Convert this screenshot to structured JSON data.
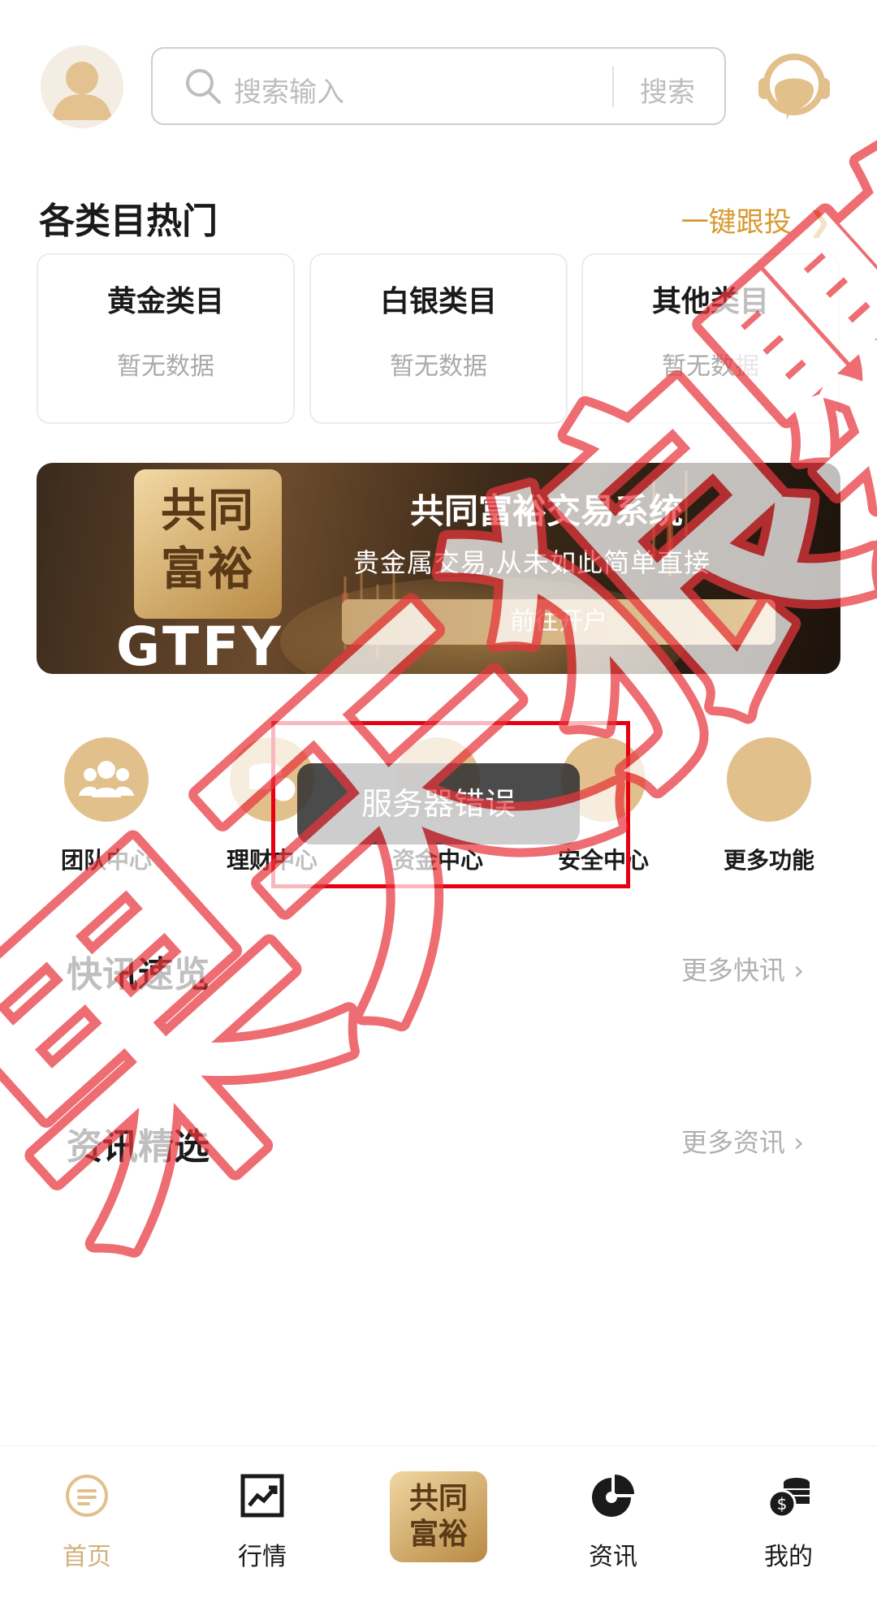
{
  "header": {
    "search_placeholder": "搜索输入",
    "search_button": "搜索"
  },
  "hot": {
    "title": "各类目热门",
    "follow_link": "一键跟投",
    "categories": [
      {
        "title": "黄金类目",
        "value": "暂无数据"
      },
      {
        "title": "白银类目",
        "value": "暂无数据"
      },
      {
        "title": "其他类目",
        "value": "暂无数据"
      }
    ]
  },
  "banner": {
    "logo_text": "共同富裕",
    "brand": "GTFY",
    "title": "共同富裕交易系统",
    "subtitle": "贵金属交易,从未如此简单直接",
    "button": "前往开户"
  },
  "features": [
    {
      "label": "团队中心",
      "icon": "team-icon"
    },
    {
      "label": "理财中心",
      "icon": "coins-icon"
    },
    {
      "label": "资金中心",
      "icon": "wallet-icon"
    },
    {
      "label": "安全中心",
      "icon": "lock-icon"
    },
    {
      "label": "更多功能",
      "icon": "more-icon"
    }
  ],
  "toast": "服务器错误",
  "flash": {
    "title": "快讯速览",
    "more": "更多快讯"
  },
  "news": {
    "title": "资讯精选",
    "more": "更多资讯"
  },
  "watermark_text": "果天狼鸚",
  "tabbar": [
    {
      "label": "首页",
      "icon": "home-icon",
      "active": true
    },
    {
      "label": "行情",
      "icon": "chart-icon",
      "active": false
    },
    {
      "label": "共同富裕",
      "icon": "logo-icon",
      "active": false
    },
    {
      "label": "资讯",
      "icon": "pie-icon",
      "active": false
    },
    {
      "label": "我的",
      "icon": "money-icon",
      "active": false
    }
  ],
  "colors": {
    "gold": "#d8992e",
    "beige": "#e2c08c",
    "watermark": "#e8363c",
    "toast_frame": "#e60012"
  }
}
